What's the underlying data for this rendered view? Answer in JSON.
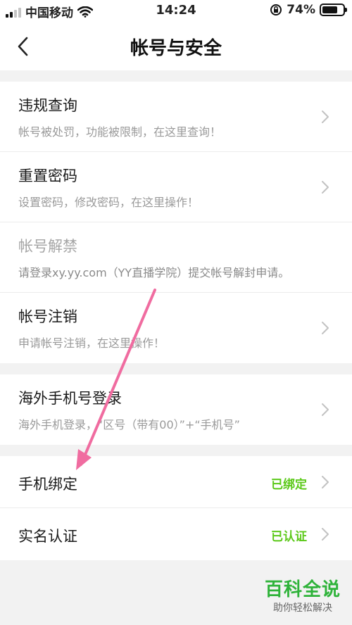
{
  "statusbar": {
    "carrier": "中国移动",
    "time": "14:24",
    "battery_percent": "74%",
    "battery_level": 0.74
  },
  "navbar": {
    "title": "帐号与安全",
    "back_icon": "chevron-left-icon"
  },
  "group1": {
    "items": [
      {
        "title": "违规查询",
        "desc": "帐号被处罚，功能被限制，在这里查询！"
      },
      {
        "title": "重置密码",
        "desc": "设置密码，修改密码，在这里操作！"
      },
      {
        "title": "帐号解禁",
        "desc": "请登录xy.yy.com（YY直播学院）提交帐号解封申请。"
      },
      {
        "title": "帐号注销",
        "desc": "申请帐号注销，在这里操作！"
      }
    ]
  },
  "group2": {
    "items": [
      {
        "title": "海外手机号登录",
        "desc": "海外手机登录，“区号（带有00）”+“手机号”"
      }
    ]
  },
  "group3": {
    "items": [
      {
        "title": "手机绑定",
        "status": "已绑定"
      },
      {
        "title": "实名认证",
        "status": "已认证"
      }
    ]
  },
  "colors": {
    "status_green": "#5cc91a",
    "annotation_arrow": "#f06ca0",
    "watermark_green": "#2fb33a"
  },
  "watermark": {
    "main": "百科全说",
    "sub": "助你轻松解决"
  }
}
